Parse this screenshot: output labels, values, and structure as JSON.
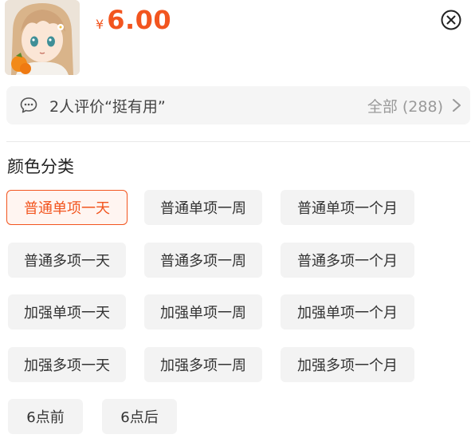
{
  "product": {
    "thumbnail": "anime-girl-thumbnail",
    "currency_symbol": "¥",
    "price": "6.00"
  },
  "icons": {
    "close": "close-circle-icon",
    "chat": "chat-bubble-icon",
    "chevron": "chevron-right-icon"
  },
  "review": {
    "text": "2人评价“挺有用”",
    "all_label": "全部 (288)"
  },
  "section": {
    "title": "颜色分类"
  },
  "options": [
    {
      "label": "普通单项一天",
      "selected": true
    },
    {
      "label": "普通单项一周",
      "selected": false
    },
    {
      "label": "普通单项一个月",
      "selected": false
    },
    {
      "label": "普通多项一天",
      "selected": false
    },
    {
      "label": "普通多项一周",
      "selected": false
    },
    {
      "label": "普通多项一个月",
      "selected": false
    },
    {
      "label": "加强单项一天",
      "selected": false
    },
    {
      "label": "加强单项一周",
      "selected": false
    },
    {
      "label": "加强单项一个月",
      "selected": false
    },
    {
      "label": "加强多项一天",
      "selected": false
    },
    {
      "label": "加强多项一周",
      "selected": false
    },
    {
      "label": "加强多项一个月",
      "selected": false
    },
    {
      "label": "6点前",
      "selected": false
    },
    {
      "label": "6点后",
      "selected": false
    }
  ],
  "colors": {
    "accent": "#f2551f",
    "chip_bg": "#f3f3f3",
    "review_bg": "#f5f5f5"
  }
}
